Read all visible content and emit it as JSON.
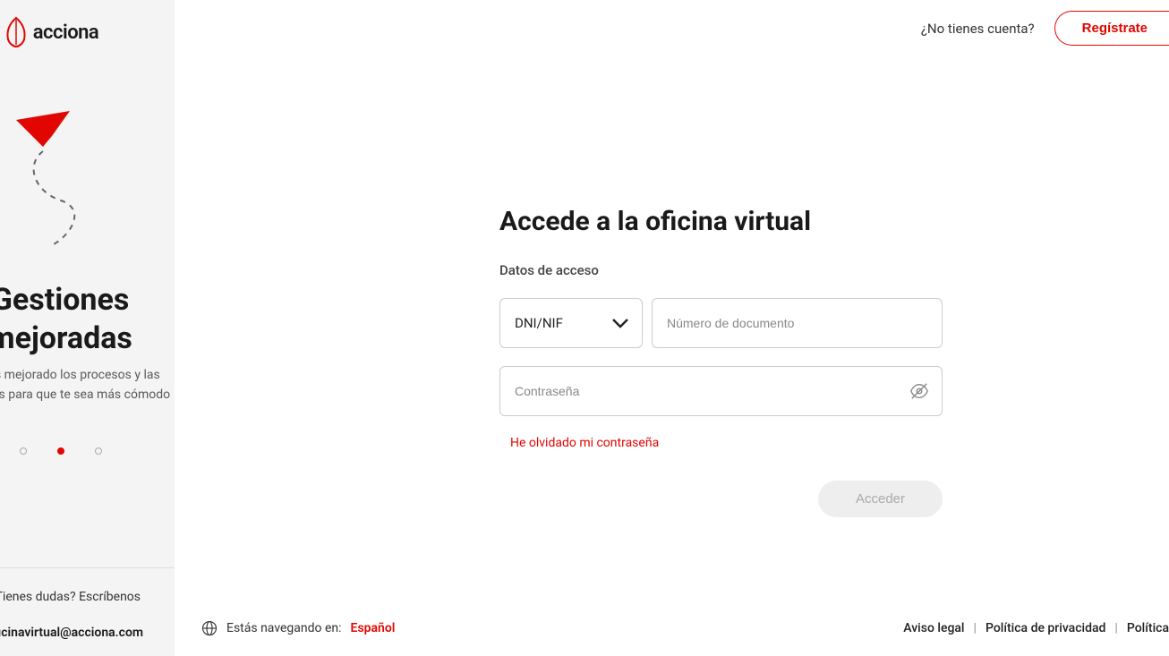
{
  "brand": "acciona",
  "sidebar": {
    "slide_title": "Gestiones mejoradas",
    "slide_desc": "Hemos mejorado los procesos y las gestiones para que te sea más cómodo",
    "dots": [
      false,
      true,
      false
    ],
    "help_text": "¿Tienes dudas? Escríbenos",
    "help_email": "oficinavirtual@acciona.com"
  },
  "header": {
    "no_account": "¿No tienes cuenta?",
    "register": "Regístrate"
  },
  "form": {
    "title": "Accede a la oficina virtual",
    "subtitle": "Datos de acceso",
    "doc_type": "DNI/NIF",
    "doc_placeholder": "Número de documento",
    "pw_placeholder": "Contraseña",
    "forgot": "He olvidado mi contraseña",
    "submit": "Acceder"
  },
  "footer": {
    "browsing": "Estás navegando en:",
    "lang": "Español",
    "legal": "Aviso legal",
    "privacy": "Política de privacidad",
    "cookies": "Política"
  }
}
